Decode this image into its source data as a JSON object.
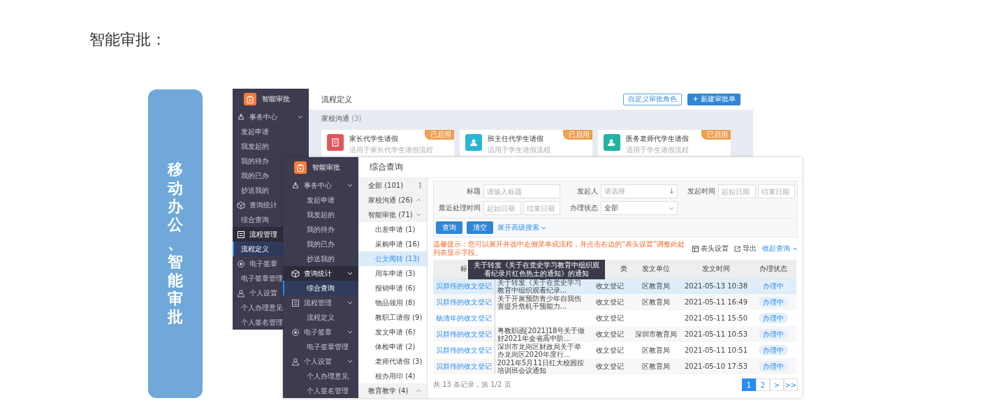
{
  "heading": "智能审批：",
  "banner": {
    "text": "移动办公、智能审批"
  },
  "back_window": {
    "app_title": "智能审批",
    "sidebar": [
      {
        "kind": "group",
        "label": "事务中心",
        "active": false,
        "expanded": true
      },
      {
        "kind": "item",
        "label": "发起申请",
        "selected": false
      },
      {
        "kind": "item",
        "label": "我发起的",
        "selected": false
      },
      {
        "kind": "item",
        "label": "我的待办",
        "selected": false
      },
      {
        "kind": "item",
        "label": "我的已办",
        "selected": false
      },
      {
        "kind": "item",
        "label": "抄送我的",
        "selected": false
      },
      {
        "kind": "group",
        "label": "查询统计",
        "active": false
      },
      {
        "kind": "item",
        "label": "综合查询",
        "selected": false
      },
      {
        "kind": "group",
        "label": "流程管理",
        "active": true
      },
      {
        "kind": "item",
        "label": "流程定义",
        "selected": true
      },
      {
        "kind": "group",
        "label": "电子签章",
        "active": false
      },
      {
        "kind": "item",
        "label": "电子签章管理",
        "selected": false
      },
      {
        "kind": "group",
        "label": "个人设置",
        "active": false
      },
      {
        "kind": "item",
        "label": "个人办理意见",
        "selected": false
      },
      {
        "kind": "item",
        "label": "个人签名管理",
        "selected": false
      }
    ],
    "page_title": "流程定义",
    "buttons": [
      {
        "label": "自定义审批角色",
        "kind": "outline"
      },
      {
        "label": "+ 新建审批单",
        "kind": "primary"
      }
    ],
    "section": {
      "title": "家校沟通",
      "count": "(3)"
    },
    "cards": [
      {
        "title": "家长代学生请假",
        "description": "适用于家长代学生请假流程",
        "badge": "已启用",
        "color": "#e0575b"
      },
      {
        "title": "班主任代学生请假",
        "description": "适用于学生请假流程",
        "badge": "已启用",
        "color": "#29b6d6"
      },
      {
        "title": "医务老师代学生请假",
        "description": "适用于学生请假流程",
        "badge": "已启用",
        "color": "#22b3a5"
      }
    ]
  },
  "front_window": {
    "app_title": "智能审批",
    "sidebar": [
      {
        "kind": "group",
        "label": "事务中心",
        "active": false,
        "expanded": true
      },
      {
        "kind": "item",
        "label": "发起申请",
        "selected": false
      },
      {
        "kind": "item",
        "label": "我发起的",
        "selected": false
      },
      {
        "kind": "item",
        "label": "我的待办",
        "selected": false
      },
      {
        "kind": "item",
        "label": "我的已办",
        "selected": false
      },
      {
        "kind": "item",
        "label": "抄送我的",
        "selected": false
      },
      {
        "kind": "group",
        "label": "查询统计",
        "active": true,
        "expanded": true
      },
      {
        "kind": "item",
        "label": "综合查询",
        "selected": true
      },
      {
        "kind": "group",
        "label": "流程管理",
        "active": false,
        "expanded": true
      },
      {
        "kind": "item",
        "label": "流程定义",
        "selected": false
      },
      {
        "kind": "group",
        "label": "电子签章",
        "active": false,
        "expanded": true
      },
      {
        "kind": "item",
        "label": "电子签章管理",
        "selected": false
      },
      {
        "kind": "group",
        "label": "个人设置",
        "active": false,
        "expanded": true
      },
      {
        "kind": "item",
        "label": "个人办理意见",
        "selected": false
      },
      {
        "kind": "item",
        "label": "个人签名管理",
        "selected": false
      }
    ],
    "page_title": "综合查询",
    "categories": [
      {
        "kind": "all",
        "label": "全部 (101)"
      },
      {
        "kind": "folder",
        "label": "家校沟通 (26)",
        "expanded": false
      },
      {
        "kind": "folder",
        "label": "智能审批 (71)",
        "expanded": true,
        "children": [
          {
            "label": "出差申请 (1)",
            "selected": false
          },
          {
            "label": "采购申请 (16)",
            "selected": false
          },
          {
            "label": "公文阅转 (13)",
            "selected": true
          },
          {
            "label": "用车申请 (3)",
            "selected": false
          },
          {
            "label": "报销申请 (6)",
            "selected": false
          },
          {
            "label": "物品领用 (8)",
            "selected": false
          },
          {
            "label": "教职工请假 (9)",
            "selected": false
          },
          {
            "label": "发文申请 (6)",
            "selected": false
          },
          {
            "label": "体检申请 (2)",
            "selected": false
          },
          {
            "label": "老师代请假 (3)",
            "selected": false
          },
          {
            "label": "校办用印 (4)",
            "selected": false
          }
        ]
      },
      {
        "kind": "folder",
        "label": "教育教学 (4)",
        "expanded": false
      }
    ],
    "filters": [
      {
        "label": "标题",
        "inputs": [
          {
            "kind": "text",
            "placeholder": "请输入标题"
          }
        ]
      },
      {
        "label": "发起人",
        "inputs": [
          {
            "kind": "picker",
            "placeholder": "请选择"
          }
        ]
      },
      {
        "label": "发起时间",
        "inputs": [
          {
            "kind": "text",
            "placeholder": "起始日期"
          },
          {
            "kind": "text",
            "placeholder": "结束日期"
          }
        ]
      },
      {
        "label": "最近处理时间",
        "inputs": [
          {
            "kind": "text",
            "placeholder": "起始日期"
          },
          {
            "kind": "text",
            "placeholder": "结束日期"
          }
        ]
      },
      {
        "label": "办理状态",
        "inputs": [
          {
            "kind": "select",
            "value": "全部"
          }
        ]
      }
    ],
    "actions": [
      {
        "label": "查询"
      },
      {
        "label": "清空"
      }
    ],
    "advanced_link": "展开高级搜索",
    "notice": "温馨提示：您可以展开并选中左侧菜单或流程，并点击右边的“表头设置”调整此处列表显示字段。",
    "tools": [
      {
        "kind": "columns",
        "label": "表头设置"
      },
      {
        "kind": "export",
        "label": "导出"
      },
      {
        "kind": "collapse",
        "label": "收起查询"
      }
    ],
    "table": {
      "columns": [
        "标",
        null,
        "类",
        "发文单位",
        "发文时间",
        "办理状态"
      ],
      "tooltip": "关于转发《关于在党史学习教育中组织观看纪录片红色热土的通知》的通知",
      "rows": [
        {
          "selected": true,
          "cells": [
            "贝群伟的收文登记",
            "关于转发《关于在党史学习教育中组织观看纪录...",
            "收文登记",
            "区教育局",
            "2021-05-13 10:38",
            "办理中"
          ]
        },
        {
          "selected": false,
          "cells": [
            "贝群伟的收文登记",
            "关于开展预防青少年自我伤害提升危机干预能力...",
            "收文登记",
            "区教育局",
            "2021-05-11 16:49",
            "办理中"
          ]
        },
        {
          "selected": false,
          "cells": [
            "杨清年的收文登记",
            null,
            "收文登记",
            null,
            "2021-05-11 15:50",
            "办理中"
          ]
        },
        {
          "selected": false,
          "cells": [
            "贝群伟的收文登记",
            "粤教职函[2021]18号关于做好2021年全省高中阶...",
            "收文登记",
            "深圳市教育局",
            "2021-05-11 10:53",
            "办理中"
          ]
        },
        {
          "selected": false,
          "cells": [
            "贝群伟的收文登记",
            "深圳市龙岗区财政局关于举办龙岗区2020年度行...",
            "收文登记",
            "区教育局",
            "2021-05-11 10:51",
            "办理中"
          ]
        },
        {
          "selected": false,
          "cells": [
            "贝群伟的收文登记",
            "2021年5月11日红大校园按培训班会议通知",
            "收文登记",
            "区教育局",
            "2021-05-10 17:53",
            "办理中"
          ]
        }
      ]
    },
    "record_info": "共 13 条记录，第 1/2 页",
    "pages": [
      {
        "label": "1",
        "selected": true
      },
      {
        "label": "2",
        "selected": false
      },
      {
        "label": ">",
        "selected": false
      },
      {
        "label": ">>",
        "selected": false
      }
    ]
  }
}
